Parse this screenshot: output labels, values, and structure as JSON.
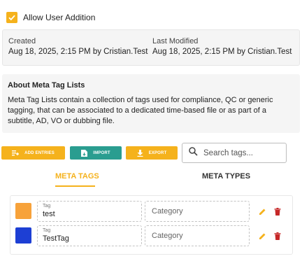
{
  "allow_user_addition": {
    "label": "Allow User Addition",
    "checked": true
  },
  "meta": {
    "created_label": "Created",
    "created_value": "Aug 18, 2025, 2:15 PM by Cristian.Test",
    "modified_label": "Last Modified",
    "modified_value": "Aug 18, 2025, 2:15 PM by Cristian.Test"
  },
  "about": {
    "title": "About Meta Tag Lists",
    "text": "Meta Tag Lists contain a collection of tags used for compliance, QC or generic tagging, that can be associated to a dedicated time-based file or as part of a subtitle, AD, VO or dubbing file."
  },
  "toolbar": {
    "add_entries": "ADD ENTRIES",
    "import": "IMPORT",
    "export": "EXPORT",
    "search_placeholder": "Search tags..."
  },
  "tabs": {
    "meta_tags": "META TAGS",
    "meta_types": "META TYPES",
    "active": "meta_tags"
  },
  "tags": [
    {
      "color": "#f7a23a",
      "tag_label": "Tag",
      "tag_value": "test",
      "category_placeholder": "Category"
    },
    {
      "color": "#1d3fd4",
      "tag_label": "Tag",
      "tag_value": "TestTag",
      "category_placeholder": "Category"
    }
  ],
  "colors": {
    "accent": "#f5b21c",
    "teal": "#2a9d90",
    "delete": "#c62828"
  }
}
